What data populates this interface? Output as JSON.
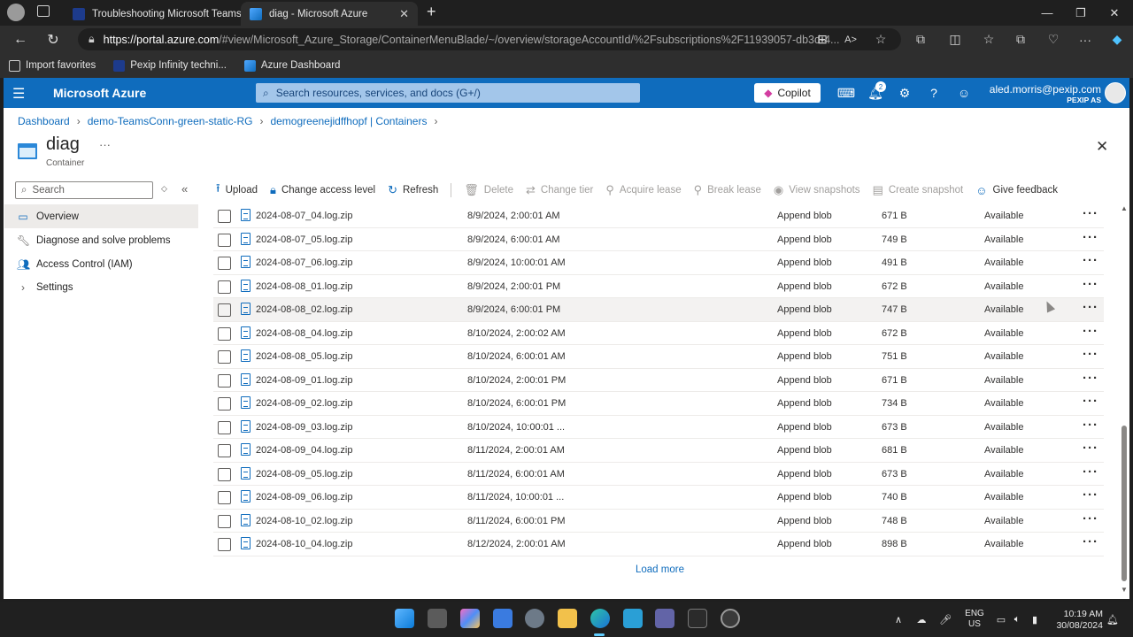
{
  "browser": {
    "tabs": [
      {
        "title": "Troubleshooting Microsoft Teams",
        "icon": "pexip-favicon"
      },
      {
        "title": "diag - Microsoft Azure",
        "icon": "azure-favicon"
      }
    ],
    "new_tab_glyph": "+",
    "url_host": "https://portal.azure.com",
    "url_path": "/#view/Microsoft_Azure_Storage/ContainerMenuBlade/~/overview/storageAccountId/%2Fsubscriptions%2F11939057-db3d-4...",
    "favorites": [
      {
        "label": "Import favorites",
        "icon": "import-icon"
      },
      {
        "label": "Pexip Infinity techni...",
        "icon": "pexip-favicon"
      },
      {
        "label": "Azure Dashboard",
        "icon": "azure-favicon"
      }
    ]
  },
  "azure": {
    "brand": "Microsoft Azure",
    "search_placeholder": "Search resources, services, and docs (G+/)",
    "copilot_label": "Copilot",
    "notification_count": "2",
    "user_email": "aled.morris@pexip.com",
    "user_org": "PEXIP AS",
    "accent_color": "#0f6cbd"
  },
  "breadcrumb": [
    "Dashboard",
    "demo-TeamsConn-green-static-RG",
    "demogreenejidffhopf | Containers"
  ],
  "page": {
    "title": "diag",
    "subtitle": "Container",
    "more_glyph": "···",
    "close_glyph": "✕"
  },
  "nav": {
    "search_placeholder": "Search",
    "items": [
      {
        "label": "Overview",
        "icon": "container-icon",
        "selected": true
      },
      {
        "label": "Diagnose and solve problems",
        "icon": "wrench-icon"
      },
      {
        "label": "Access Control (IAM)",
        "icon": "people-icon"
      },
      {
        "label": "Settings",
        "icon": "chevron-right-icon"
      }
    ]
  },
  "toolbar": {
    "upload": "Upload",
    "change_access": "Change access level",
    "refresh": "Refresh",
    "delete": "Delete",
    "change_tier": "Change tier",
    "acquire_lease": "Acquire lease",
    "break_lease": "Break lease",
    "view_snapshots": "View snapshots",
    "create_snapshot": "Create snapshot",
    "give_feedback": "Give feedback"
  },
  "blobs": [
    {
      "name": "2024-08-07_04.log.zip",
      "modified": "8/9/2024, 2:00:01 AM",
      "type": "Append blob",
      "size": "671 B",
      "status": "Available"
    },
    {
      "name": "2024-08-07_05.log.zip",
      "modified": "8/9/2024, 6:00:01 AM",
      "type": "Append blob",
      "size": "749 B",
      "status": "Available"
    },
    {
      "name": "2024-08-07_06.log.zip",
      "modified": "8/9/2024, 10:00:01 AM",
      "type": "Append blob",
      "size": "491 B",
      "status": "Available"
    },
    {
      "name": "2024-08-08_01.log.zip",
      "modified": "8/9/2024, 2:00:01 PM",
      "type": "Append blob",
      "size": "672 B",
      "status": "Available"
    },
    {
      "name": "2024-08-08_02.log.zip",
      "modified": "8/9/2024, 6:00:01 PM",
      "type": "Append blob",
      "size": "747 B",
      "status": "Available"
    },
    {
      "name": "2024-08-08_04.log.zip",
      "modified": "8/10/2024, 2:00:02 AM",
      "type": "Append blob",
      "size": "672 B",
      "status": "Available"
    },
    {
      "name": "2024-08-08_05.log.zip",
      "modified": "8/10/2024, 6:00:01 AM",
      "type": "Append blob",
      "size": "751 B",
      "status": "Available"
    },
    {
      "name": "2024-08-09_01.log.zip",
      "modified": "8/10/2024, 2:00:01 PM",
      "type": "Append blob",
      "size": "671 B",
      "status": "Available"
    },
    {
      "name": "2024-08-09_02.log.zip",
      "modified": "8/10/2024, 6:00:01 PM",
      "type": "Append blob",
      "size": "734 B",
      "status": "Available"
    },
    {
      "name": "2024-08-09_03.log.zip",
      "modified": "8/10/2024, 10:00:01 ...",
      "type": "Append blob",
      "size": "673 B",
      "status": "Available"
    },
    {
      "name": "2024-08-09_04.log.zip",
      "modified": "8/11/2024, 2:00:01 AM",
      "type": "Append blob",
      "size": "681 B",
      "status": "Available"
    },
    {
      "name": "2024-08-09_05.log.zip",
      "modified": "8/11/2024, 6:00:01 AM",
      "type": "Append blob",
      "size": "673 B",
      "status": "Available"
    },
    {
      "name": "2024-08-09_06.log.zip",
      "modified": "8/11/2024, 10:00:01 ...",
      "type": "Append blob",
      "size": "740 B",
      "status": "Available"
    },
    {
      "name": "2024-08-10_02.log.zip",
      "modified": "8/11/2024, 6:00:01 PM",
      "type": "Append blob",
      "size": "748 B",
      "status": "Available"
    },
    {
      "name": "2024-08-10_04.log.zip",
      "modified": "8/12/2024, 2:00:01 AM",
      "type": "Append blob",
      "size": "898 B",
      "status": "Available"
    }
  ],
  "load_more": "Load more",
  "taskbar": {
    "lang_line1": "ENG",
    "lang_line2": "US",
    "time": "10:19 AM",
    "date": "30/08/2024"
  }
}
